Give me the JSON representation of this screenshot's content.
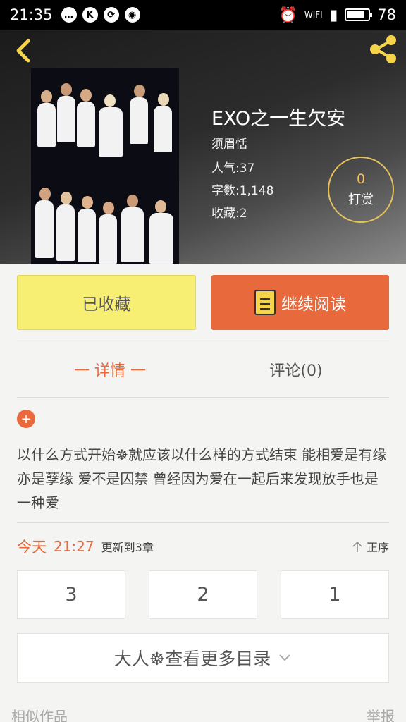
{
  "status_bar": {
    "time": "21:35",
    "battery": "78",
    "left_icons": [
      "message-icon",
      "k-app-icon",
      "sync-icon",
      "weibo-icon"
    ],
    "right_icons": [
      "alarm-icon",
      "wifi-icon",
      "signal-icon",
      "battery-icon"
    ],
    "wifi_label": "WIFI"
  },
  "header": {
    "book_title": "EXO之一生欠安",
    "author": "须眉恬",
    "popularity": "人气:37",
    "word_count": "字数:1,148",
    "favorites": "收藏:2",
    "reward_count": "0",
    "reward_label": "打赏"
  },
  "actions": {
    "favorite_label": "已收藏",
    "read_label": "继续阅读"
  },
  "tabs": {
    "detail": "一 详情 一",
    "comments": "评论(0)"
  },
  "description": {
    "expand": "+",
    "text": "以什么方式开始☸就应该以什么样的方式结束 能相爱是有缘 亦是孽缘 爱不是囚禁 曾经因为爱在一起后来发现放手也是一种爱"
  },
  "update": {
    "today": "今天",
    "time": "21:27",
    "status": "更新到3章",
    "sort": "正序"
  },
  "chapters": [
    "3",
    "2",
    "1"
  ],
  "more": {
    "label": "大人☸查看更多目录"
  },
  "footer": {
    "similar": "相似作品",
    "report": "举报"
  },
  "colors": {
    "accent": "#e86a3c",
    "favorite_bg": "#f7ef73",
    "reward_ring": "#e6c25a"
  }
}
